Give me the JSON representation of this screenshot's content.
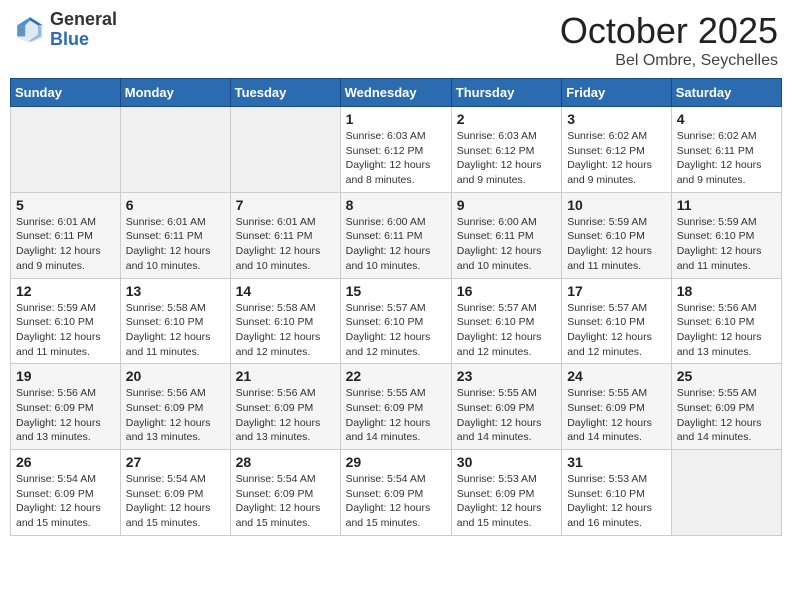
{
  "header": {
    "logo_general": "General",
    "logo_blue": "Blue",
    "month_title": "October 2025",
    "subtitle": "Bel Ombre, Seychelles"
  },
  "weekdays": [
    "Sunday",
    "Monday",
    "Tuesday",
    "Wednesday",
    "Thursday",
    "Friday",
    "Saturday"
  ],
  "weeks": [
    [
      {
        "day": "",
        "info": ""
      },
      {
        "day": "",
        "info": ""
      },
      {
        "day": "",
        "info": ""
      },
      {
        "day": "1",
        "info": "Sunrise: 6:03 AM\nSunset: 6:12 PM\nDaylight: 12 hours\nand 8 minutes."
      },
      {
        "day": "2",
        "info": "Sunrise: 6:03 AM\nSunset: 6:12 PM\nDaylight: 12 hours\nand 9 minutes."
      },
      {
        "day": "3",
        "info": "Sunrise: 6:02 AM\nSunset: 6:12 PM\nDaylight: 12 hours\nand 9 minutes."
      },
      {
        "day": "4",
        "info": "Sunrise: 6:02 AM\nSunset: 6:11 PM\nDaylight: 12 hours\nand 9 minutes."
      }
    ],
    [
      {
        "day": "5",
        "info": "Sunrise: 6:01 AM\nSunset: 6:11 PM\nDaylight: 12 hours\nand 9 minutes."
      },
      {
        "day": "6",
        "info": "Sunrise: 6:01 AM\nSunset: 6:11 PM\nDaylight: 12 hours\nand 10 minutes."
      },
      {
        "day": "7",
        "info": "Sunrise: 6:01 AM\nSunset: 6:11 PM\nDaylight: 12 hours\nand 10 minutes."
      },
      {
        "day": "8",
        "info": "Sunrise: 6:00 AM\nSunset: 6:11 PM\nDaylight: 12 hours\nand 10 minutes."
      },
      {
        "day": "9",
        "info": "Sunrise: 6:00 AM\nSunset: 6:11 PM\nDaylight: 12 hours\nand 10 minutes."
      },
      {
        "day": "10",
        "info": "Sunrise: 5:59 AM\nSunset: 6:10 PM\nDaylight: 12 hours\nand 11 minutes."
      },
      {
        "day": "11",
        "info": "Sunrise: 5:59 AM\nSunset: 6:10 PM\nDaylight: 12 hours\nand 11 minutes."
      }
    ],
    [
      {
        "day": "12",
        "info": "Sunrise: 5:59 AM\nSunset: 6:10 PM\nDaylight: 12 hours\nand 11 minutes."
      },
      {
        "day": "13",
        "info": "Sunrise: 5:58 AM\nSunset: 6:10 PM\nDaylight: 12 hours\nand 11 minutes."
      },
      {
        "day": "14",
        "info": "Sunrise: 5:58 AM\nSunset: 6:10 PM\nDaylight: 12 hours\nand 12 minutes."
      },
      {
        "day": "15",
        "info": "Sunrise: 5:57 AM\nSunset: 6:10 PM\nDaylight: 12 hours\nand 12 minutes."
      },
      {
        "day": "16",
        "info": "Sunrise: 5:57 AM\nSunset: 6:10 PM\nDaylight: 12 hours\nand 12 minutes."
      },
      {
        "day": "17",
        "info": "Sunrise: 5:57 AM\nSunset: 6:10 PM\nDaylight: 12 hours\nand 12 minutes."
      },
      {
        "day": "18",
        "info": "Sunrise: 5:56 AM\nSunset: 6:10 PM\nDaylight: 12 hours\nand 13 minutes."
      }
    ],
    [
      {
        "day": "19",
        "info": "Sunrise: 5:56 AM\nSunset: 6:09 PM\nDaylight: 12 hours\nand 13 minutes."
      },
      {
        "day": "20",
        "info": "Sunrise: 5:56 AM\nSunset: 6:09 PM\nDaylight: 12 hours\nand 13 minutes."
      },
      {
        "day": "21",
        "info": "Sunrise: 5:56 AM\nSunset: 6:09 PM\nDaylight: 12 hours\nand 13 minutes."
      },
      {
        "day": "22",
        "info": "Sunrise: 5:55 AM\nSunset: 6:09 PM\nDaylight: 12 hours\nand 14 minutes."
      },
      {
        "day": "23",
        "info": "Sunrise: 5:55 AM\nSunset: 6:09 PM\nDaylight: 12 hours\nand 14 minutes."
      },
      {
        "day": "24",
        "info": "Sunrise: 5:55 AM\nSunset: 6:09 PM\nDaylight: 12 hours\nand 14 minutes."
      },
      {
        "day": "25",
        "info": "Sunrise: 5:55 AM\nSunset: 6:09 PM\nDaylight: 12 hours\nand 14 minutes."
      }
    ],
    [
      {
        "day": "26",
        "info": "Sunrise: 5:54 AM\nSunset: 6:09 PM\nDaylight: 12 hours\nand 15 minutes."
      },
      {
        "day": "27",
        "info": "Sunrise: 5:54 AM\nSunset: 6:09 PM\nDaylight: 12 hours\nand 15 minutes."
      },
      {
        "day": "28",
        "info": "Sunrise: 5:54 AM\nSunset: 6:09 PM\nDaylight: 12 hours\nand 15 minutes."
      },
      {
        "day": "29",
        "info": "Sunrise: 5:54 AM\nSunset: 6:09 PM\nDaylight: 12 hours\nand 15 minutes."
      },
      {
        "day": "30",
        "info": "Sunrise: 5:53 AM\nSunset: 6:09 PM\nDaylight: 12 hours\nand 15 minutes."
      },
      {
        "day": "31",
        "info": "Sunrise: 5:53 AM\nSunset: 6:10 PM\nDaylight: 12 hours\nand 16 minutes."
      },
      {
        "day": "",
        "info": ""
      }
    ]
  ]
}
